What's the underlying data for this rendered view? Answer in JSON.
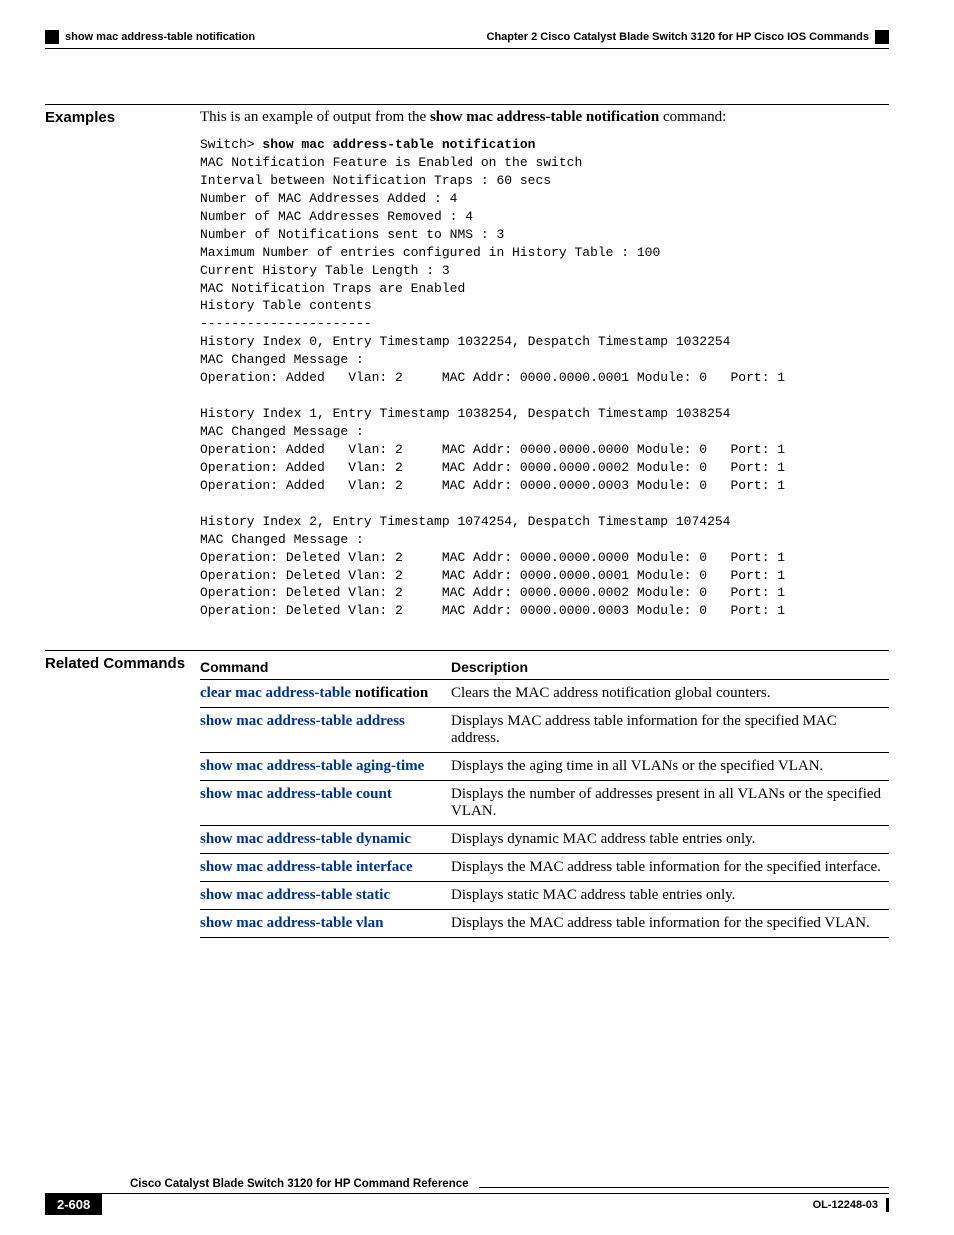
{
  "header": {
    "chapter": "Chapter 2  Cisco Catalyst Blade Switch 3120 for HP Cisco IOS Commands",
    "running_section": "show mac address-table notification"
  },
  "examples": {
    "label": "Examples",
    "intro_pre": "This is an example of output from the ",
    "intro_cmd": "show mac address-table notification",
    "intro_post": " command:",
    "prompt": "Switch> ",
    "cli_command": "show mac address-table notification",
    "output": "MAC Notification Feature is Enabled on the switch\nInterval between Notification Traps : 60 secs\nNumber of MAC Addresses Added : 4\nNumber of MAC Addresses Removed : 4\nNumber of Notifications sent to NMS : 3\nMaximum Number of entries configured in History Table : 100\nCurrent History Table Length : 3\nMAC Notification Traps are Enabled\nHistory Table contents\n----------------------\nHistory Index 0, Entry Timestamp 1032254, Despatch Timestamp 1032254\nMAC Changed Message :\nOperation: Added   Vlan: 2     MAC Addr: 0000.0000.0001 Module: 0   Port: 1\n\nHistory Index 1, Entry Timestamp 1038254, Despatch Timestamp 1038254\nMAC Changed Message :\nOperation: Added   Vlan: 2     MAC Addr: 0000.0000.0000 Module: 0   Port: 1\nOperation: Added   Vlan: 2     MAC Addr: 0000.0000.0002 Module: 0   Port: 1\nOperation: Added   Vlan: 2     MAC Addr: 0000.0000.0003 Module: 0   Port: 1\n\nHistory Index 2, Entry Timestamp 1074254, Despatch Timestamp 1074254\nMAC Changed Message :\nOperation: Deleted Vlan: 2     MAC Addr: 0000.0000.0000 Module: 0   Port: 1\nOperation: Deleted Vlan: 2     MAC Addr: 0000.0000.0001 Module: 0   Port: 1\nOperation: Deleted Vlan: 2     MAC Addr: 0000.0000.0002 Module: 0   Port: 1\nOperation: Deleted Vlan: 2     MAC Addr: 0000.0000.0003 Module: 0   Port: 1"
  },
  "related": {
    "label": "Related Commands",
    "col_command": "Command",
    "col_description": "Description",
    "rows": [
      {
        "cmd_link": "clear mac address-table",
        "cmd_plain": " notification",
        "desc": "Clears the MAC address notification global counters."
      },
      {
        "cmd_link": "show mac address-table address",
        "cmd_plain": "",
        "desc": "Displays MAC address table information for the specified MAC address."
      },
      {
        "cmd_link": "show mac address-table aging-time",
        "cmd_plain": "",
        "desc": "Displays the aging time in all VLANs or the specified VLAN."
      },
      {
        "cmd_link": "show mac address-table count",
        "cmd_plain": "",
        "desc": "Displays the number of addresses present in all VLANs or the specified VLAN."
      },
      {
        "cmd_link": "show mac address-table dynamic",
        "cmd_plain": "",
        "desc": "Displays dynamic MAC address table entries only."
      },
      {
        "cmd_link": "show mac address-table interface",
        "cmd_plain": "",
        "desc": "Displays the MAC address table information for the specified interface."
      },
      {
        "cmd_link": "show mac address-table static",
        "cmd_plain": "",
        "desc": "Displays static MAC address table entries only."
      },
      {
        "cmd_link": "show mac address-table vlan",
        "cmd_plain": "",
        "desc": "Displays the MAC address table information for the specified VLAN."
      }
    ]
  },
  "footer": {
    "book_title": "Cisco Catalyst Blade Switch 3120 for HP Command Reference",
    "page_number": "2-608",
    "doc_id": "OL-12248-03"
  }
}
